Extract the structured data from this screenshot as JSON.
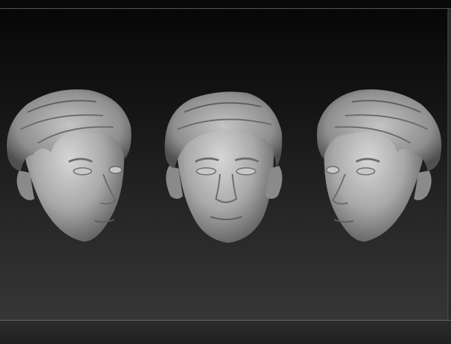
{
  "viewport": {
    "background_top": "#070707",
    "background_bottom": "#363636",
    "sculpt_color": "#b8b8b8"
  },
  "models": [
    {
      "view": "three-quarter-left"
    },
    {
      "view": "front"
    },
    {
      "view": "three-quarter-right"
    }
  ]
}
